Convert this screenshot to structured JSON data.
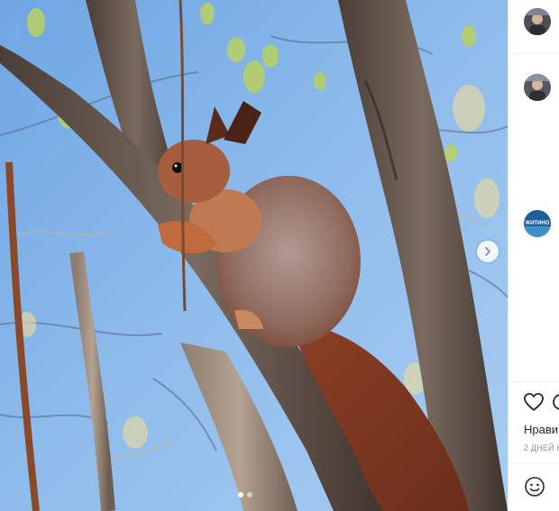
{
  "post": {
    "image_alt": "",
    "carousel": {
      "slide_count": 2,
      "active_index": 0
    }
  },
  "sidebar": {
    "comments": [
      {
        "avatar_icon": "user-avatar-icon"
      },
      {
        "avatar_icon": "user-avatar-icon"
      },
      {
        "avatar_icon": "org-avatar-icon",
        "avatar_text": "ЖИТИНО"
      }
    ],
    "likes_label": "Нрави",
    "date_label": "2 ДНЕЙ Н"
  },
  "icons": {
    "like": "heart-icon",
    "comment": "comment-icon",
    "emoji": "smile-icon",
    "next": "chevron-right-icon"
  },
  "colors": {
    "text": "#262626",
    "muted": "#8e8e8e",
    "divider": "#efefef",
    "sky": "#7fb2e6"
  }
}
